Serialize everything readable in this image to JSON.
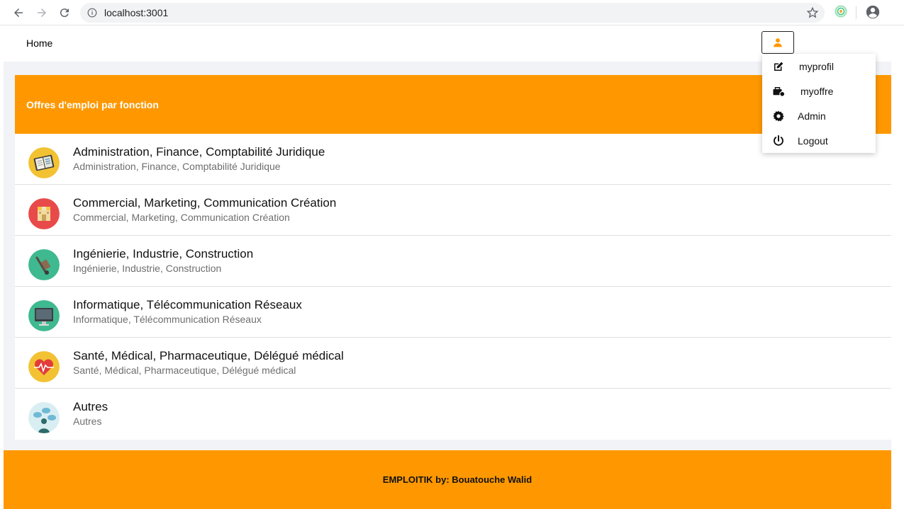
{
  "browser": {
    "url": "localhost:3001",
    "icons": [
      "back-arrow-icon",
      "forward-arrow-icon",
      "reload-icon",
      "info-icon",
      "star-icon",
      "extension-icon",
      "account-circle-icon"
    ]
  },
  "header": {
    "home_label": "Home",
    "user_icon": "person-icon"
  },
  "menu": {
    "items": [
      {
        "label": "myprofil",
        "icon": "edit-icon"
      },
      {
        "label": "myoffre",
        "icon": "briefcase-icon"
      },
      {
        "label": "Admin",
        "icon": "gear-icon"
      },
      {
        "label": "Logout",
        "icon": "power-icon"
      }
    ]
  },
  "card": {
    "title": "Offres d'emploi par fonction",
    "items": [
      {
        "title": "Administration, Finance, Comptabilité Juridique",
        "subtitle": "Administration, Finance, Comptabilité Juridique",
        "icon": "notebook-icon"
      },
      {
        "title": "Commercial, Marketing, Communication Création",
        "subtitle": "Commercial, Marketing, Communication Création",
        "icon": "shop-icon"
      },
      {
        "title": "Ingénierie, Industrie, Construction",
        "subtitle": "Ingénierie, Industrie, Construction",
        "icon": "hand-truck-icon"
      },
      {
        "title": "Informatique, Télécommunication Réseaux",
        "subtitle": "Informatique, Télécommunication Réseaux",
        "icon": "monitor-icon"
      },
      {
        "title": "Santé, Médical, Pharmaceutique, Délégué médical",
        "subtitle": "Santé, Médical, Pharmaceutique, Délégué médical",
        "icon": "heart-pulse-icon"
      },
      {
        "title": "Autres",
        "subtitle": "Autres",
        "icon": "chat-person-icon"
      }
    ]
  },
  "footer": {
    "text": "EMPLOITIK by: Bouatouche Walid"
  },
  "colors": {
    "accent": "#ff9800",
    "page_bg": "#f1f3f7",
    "text": "#111111",
    "subtext": "#6e6e6e"
  }
}
